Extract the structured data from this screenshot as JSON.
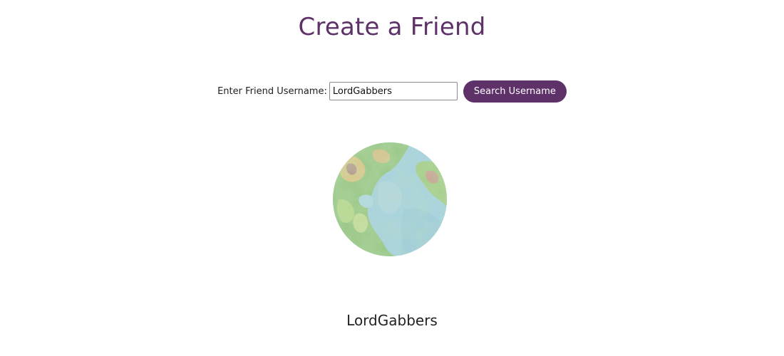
{
  "header": {
    "title": "Create a Friend"
  },
  "search": {
    "label": "Enter Friend Username:",
    "value": "LordGabbers",
    "placeholder": "",
    "button_label": "Search Username"
  },
  "result": {
    "username": "LordGabbers",
    "avatar_icon": "planet-globe-icon"
  },
  "colors": {
    "accent": "#5e3169",
    "text": "#222222",
    "background": "#ffffff"
  }
}
